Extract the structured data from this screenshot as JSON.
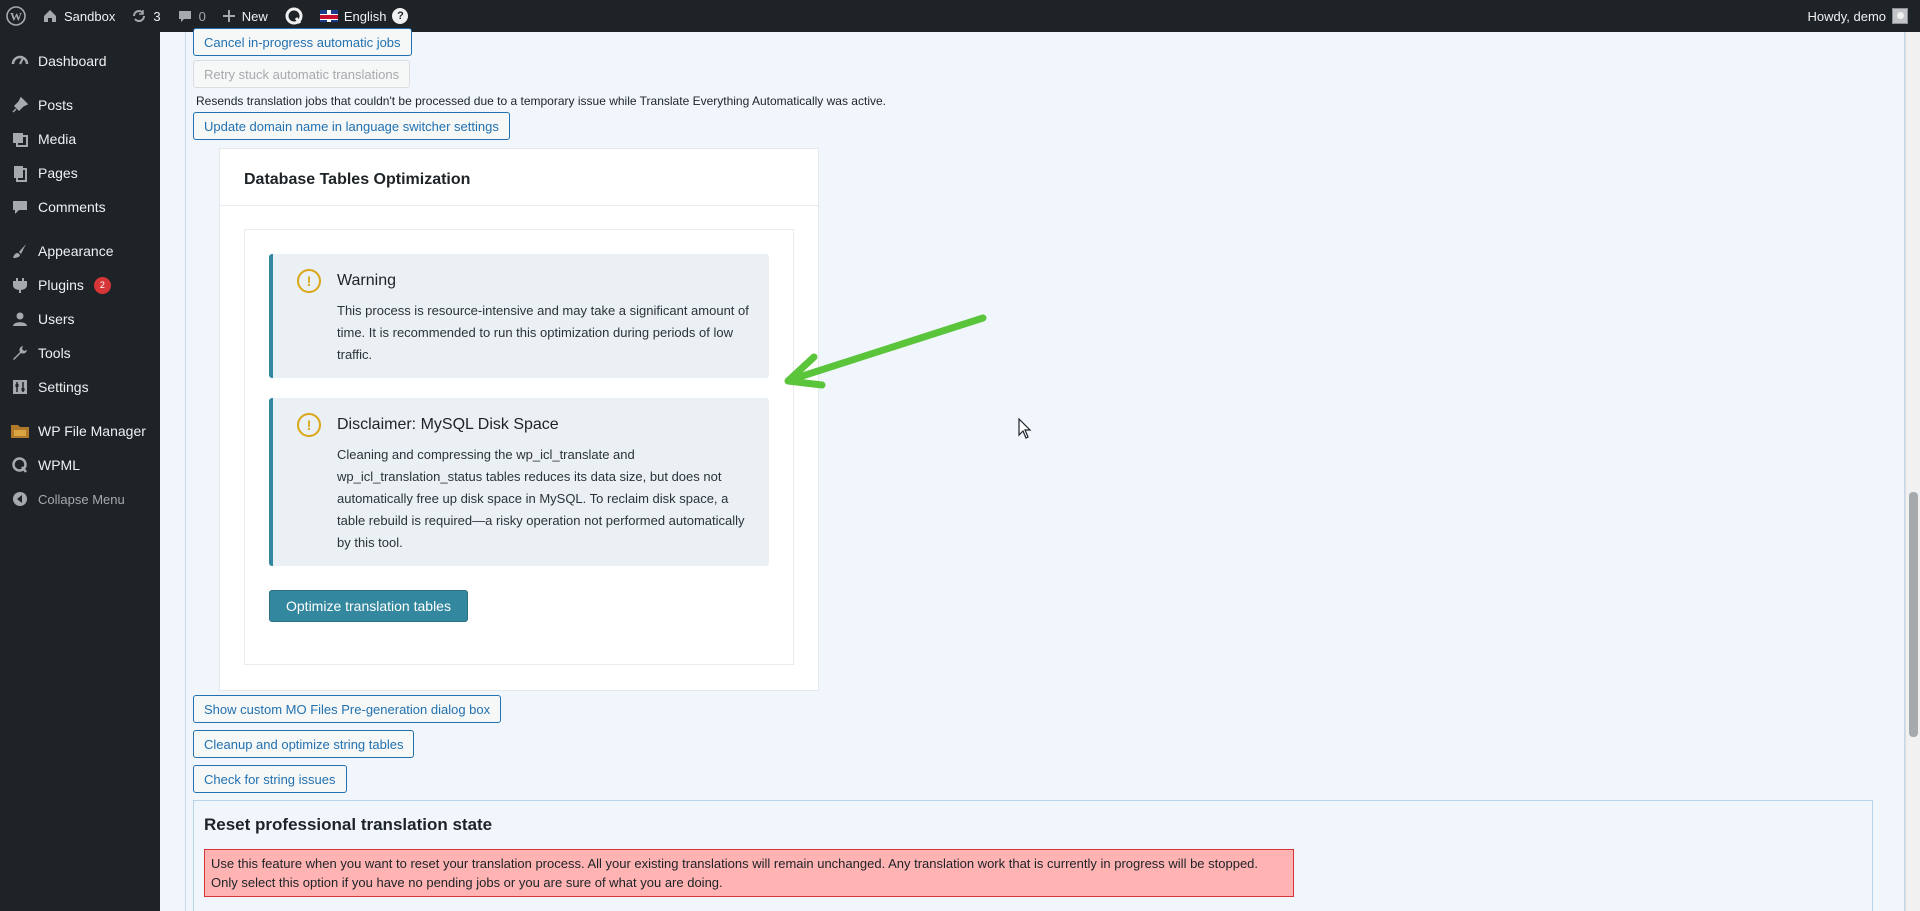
{
  "adminbar": {
    "site_name": "Sandbox",
    "updates_count": "3",
    "comments_count": "0",
    "new_label": "New",
    "language_label": "English",
    "help_glyph": "?",
    "greeting": "Howdy, demo"
  },
  "sidebar": {
    "items": [
      {
        "label": "Dashboard",
        "icon": "dashboard-icon"
      },
      {
        "label": "Posts",
        "icon": "pin-icon"
      },
      {
        "label": "Media",
        "icon": "media-icon"
      },
      {
        "label": "Pages",
        "icon": "pages-icon"
      },
      {
        "label": "Comments",
        "icon": "comment-icon"
      },
      {
        "label": "Appearance",
        "icon": "brush-icon"
      },
      {
        "label": "Plugins",
        "icon": "plugin-icon",
        "badge": "2"
      },
      {
        "label": "Users",
        "icon": "user-icon"
      },
      {
        "label": "Tools",
        "icon": "wrench-icon"
      },
      {
        "label": "Settings",
        "icon": "settings-icon"
      },
      {
        "label": "WP File Manager",
        "icon": "folder-icon"
      },
      {
        "label": "WPML",
        "icon": "wpml-icon"
      },
      {
        "label": "Collapse Menu",
        "icon": "collapse-icon"
      }
    ]
  },
  "main": {
    "btn_cancel_jobs": "Cancel in-progress automatic jobs",
    "btn_retry_stuck": "Retry stuck automatic translations",
    "retry_help": "Resends translation jobs that couldn't be processed due to a temporary issue while Translate Everything Automatically was active.",
    "btn_update_domain": "Update domain name in language switcher settings",
    "db_card": {
      "title": "Database Tables Optimization",
      "warning_title": "Warning",
      "warning_text": "This process is resource-intensive and may take a significant amount of time. It is recommended to run this optimization during periods of low traffic.",
      "disclaimer_title": "Disclaimer: MySQL Disk Space",
      "disclaimer_text": "Cleaning and compressing the wp_icl_translate and wp_icl_translation_status tables reduces its data size, but does not automatically free up disk space in MySQL. To reclaim disk space, a table rebuild is required—a risky operation not performed automatically by this tool.",
      "notice_glyph": "!",
      "btn_optimize": "Optimize translation tables"
    },
    "btn_mo_files": "Show custom MO Files Pre-generation dialog box",
    "btn_cleanup_strings": "Cleanup and optimize string tables",
    "btn_check_strings": "Check for string issues",
    "reset": {
      "title": "Reset professional translation state",
      "alert_line1": "Use this feature when you want to reset your translation process. All your existing translations will remain unchanged. Any translation work that is currently in progress will be stopped.",
      "alert_line2": "Only select this option if you have no pending jobs or you are sure of what you are doing."
    }
  },
  "colors": {
    "adminbar_bg": "#1d2327",
    "accent": "#2271b1",
    "notice_border": "#33879e",
    "warning_icon": "#dba617",
    "alert_bg": "#ffb3b3",
    "arrow": "#5ac43b"
  }
}
